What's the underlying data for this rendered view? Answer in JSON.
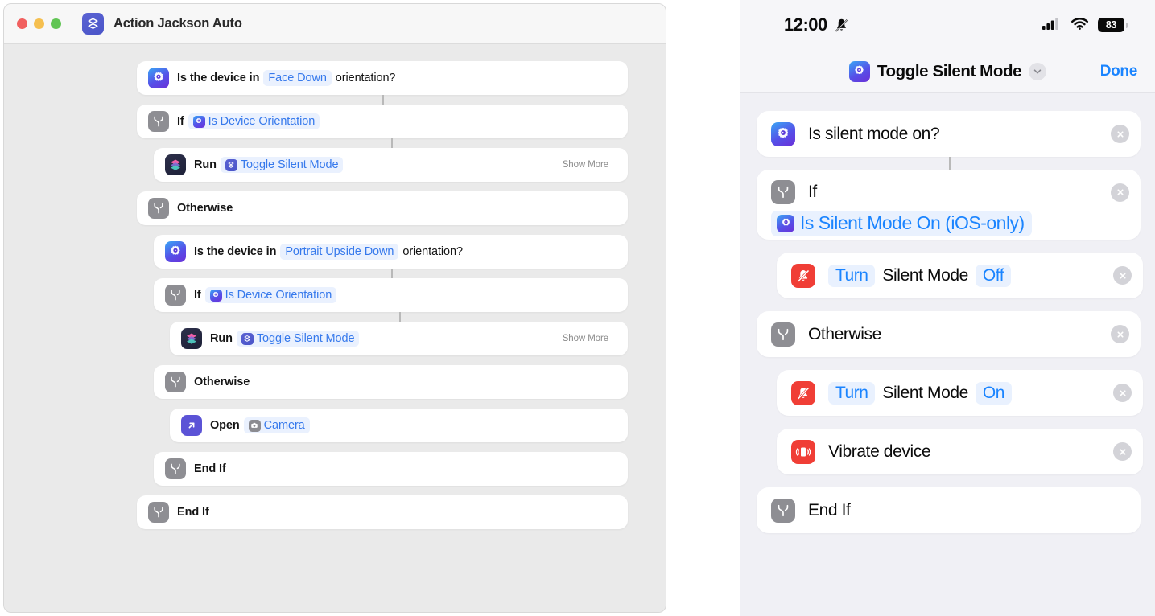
{
  "colors": {
    "accent_blue": "#1a84ff",
    "chip_blue": "#3679ec",
    "chip_bg": "#eaf1fe",
    "red_action": "#f03e36",
    "gray_branch": "#8e8e93",
    "mac_bg": "#eaeaea",
    "phone_bg": "#f0f0f5"
  },
  "mac_window": {
    "title": "Action Jackson Auto",
    "app_icon": "shortcuts-icon",
    "traffic_lights": [
      "close",
      "minimize",
      "zoom"
    ],
    "rows": [
      {
        "id": "is-device-in-face-down",
        "indent": 0,
        "icon": "gear-play-icon",
        "parts": [
          {
            "type": "text",
            "value": "Is the device in"
          },
          {
            "type": "chip",
            "value": "Face Down"
          },
          {
            "type": "text",
            "value": "orientation?"
          }
        ],
        "show_more": null
      },
      {
        "id": "if-is-device-orientation-1",
        "indent": 0,
        "icon": "branch-icon",
        "parts": [
          {
            "type": "text",
            "value": "If"
          },
          {
            "type": "chip",
            "value": "Is Device Orientation",
            "chip_icon": "gear-play-icon"
          }
        ],
        "show_more": null
      },
      {
        "id": "run-toggle-silent-mode-1",
        "indent": 1,
        "icon": "shortcuts-run-icon",
        "parts": [
          {
            "type": "text",
            "value": "Run"
          },
          {
            "type": "chip",
            "value": "Toggle Silent Mode",
            "chip_icon": "shortcuts-icon"
          }
        ],
        "show_more": "Show More"
      },
      {
        "id": "otherwise-1",
        "indent": 0,
        "icon": "branch-icon",
        "parts": [
          {
            "type": "text",
            "value": "Otherwise"
          }
        ],
        "show_more": null
      },
      {
        "id": "is-device-in-portrait-upside-down",
        "indent": 1,
        "icon": "gear-play-icon",
        "parts": [
          {
            "type": "text",
            "value": "Is the device in"
          },
          {
            "type": "chip",
            "value": "Portrait Upside Down"
          },
          {
            "type": "text",
            "value": "orientation?"
          }
        ],
        "show_more": null
      },
      {
        "id": "if-is-device-orientation-2",
        "indent": 1,
        "icon": "branch-icon",
        "parts": [
          {
            "type": "text",
            "value": "If"
          },
          {
            "type": "chip",
            "value": "Is Device Orientation",
            "chip_icon": "gear-play-icon"
          }
        ],
        "show_more": null
      },
      {
        "id": "run-toggle-silent-mode-2",
        "indent": 2,
        "icon": "shortcuts-run-icon",
        "parts": [
          {
            "type": "text",
            "value": "Run"
          },
          {
            "type": "chip",
            "value": "Toggle Silent Mode",
            "chip_icon": "shortcuts-icon"
          }
        ],
        "show_more": "Show More"
      },
      {
        "id": "otherwise-2",
        "indent": 1,
        "icon": "branch-icon",
        "parts": [
          {
            "type": "text",
            "value": "Otherwise"
          }
        ],
        "show_more": null
      },
      {
        "id": "open-camera",
        "indent": 2,
        "icon": "open-app-icon",
        "parts": [
          {
            "type": "text",
            "value": "Open"
          },
          {
            "type": "chip",
            "value": "Camera",
            "chip_icon": "camera-icon"
          }
        ],
        "show_more": null
      },
      {
        "id": "end-if-1",
        "indent": 1,
        "icon": "branch-icon",
        "parts": [
          {
            "type": "text",
            "value": "End If"
          }
        ],
        "show_more": null
      },
      {
        "id": "end-if-2",
        "indent": 0,
        "icon": "branch-icon",
        "parts": [
          {
            "type": "text",
            "value": "End If"
          }
        ],
        "show_more": null
      }
    ]
  },
  "phone": {
    "status_bar": {
      "time": "12:00",
      "silent_icon": "bell-slash-icon",
      "cellular_icon": "cellular-bars-icon",
      "wifi_icon": "wifi-icon",
      "battery_level": "83"
    },
    "nav_bar": {
      "icon": "gear-play-icon",
      "title": "Toggle Silent Mode",
      "chevron": "chevron-down-icon",
      "done_label": "Done"
    },
    "rows": [
      {
        "id": "is-silent-mode-on",
        "indent": 0,
        "icon": "gear-play-icon",
        "layout": "single",
        "parts": [
          {
            "type": "text",
            "value": "Is silent mode on?"
          }
        ],
        "has_delete": true
      },
      {
        "id": "if-is-silent-mode-on",
        "indent": 0,
        "icon": "branch-icon",
        "layout": "two-line",
        "parts": [
          {
            "type": "text",
            "value": "If"
          }
        ],
        "condition": {
          "type": "chip",
          "value": "Is Silent Mode On (iOS-only)",
          "chip_icon": "gear-play-icon"
        },
        "has_delete": true
      },
      {
        "id": "turn-silent-mode-off",
        "indent": 1,
        "icon": "bell-slash-red-icon",
        "layout": "single",
        "parts": [
          {
            "type": "chip",
            "value": "Turn"
          },
          {
            "type": "text",
            "value": "Silent Mode"
          },
          {
            "type": "chip",
            "value": "Off"
          }
        ],
        "has_delete": true
      },
      {
        "id": "otherwise",
        "indent": 0,
        "icon": "branch-icon",
        "layout": "single",
        "parts": [
          {
            "type": "text",
            "value": "Otherwise"
          }
        ],
        "has_delete": true
      },
      {
        "id": "turn-silent-mode-on",
        "indent": 1,
        "icon": "bell-slash-red-icon",
        "layout": "single",
        "parts": [
          {
            "type": "chip",
            "value": "Turn"
          },
          {
            "type": "text",
            "value": "Silent Mode"
          },
          {
            "type": "chip",
            "value": "On"
          }
        ],
        "has_delete": true
      },
      {
        "id": "vibrate-device",
        "indent": 1,
        "icon": "vibrate-icon",
        "layout": "single",
        "parts": [
          {
            "type": "text",
            "value": "Vibrate device"
          }
        ],
        "has_delete": true
      },
      {
        "id": "end-if",
        "indent": 0,
        "icon": "branch-icon",
        "layout": "single",
        "parts": [
          {
            "type": "text",
            "value": "End If"
          }
        ],
        "has_delete": false
      }
    ]
  }
}
